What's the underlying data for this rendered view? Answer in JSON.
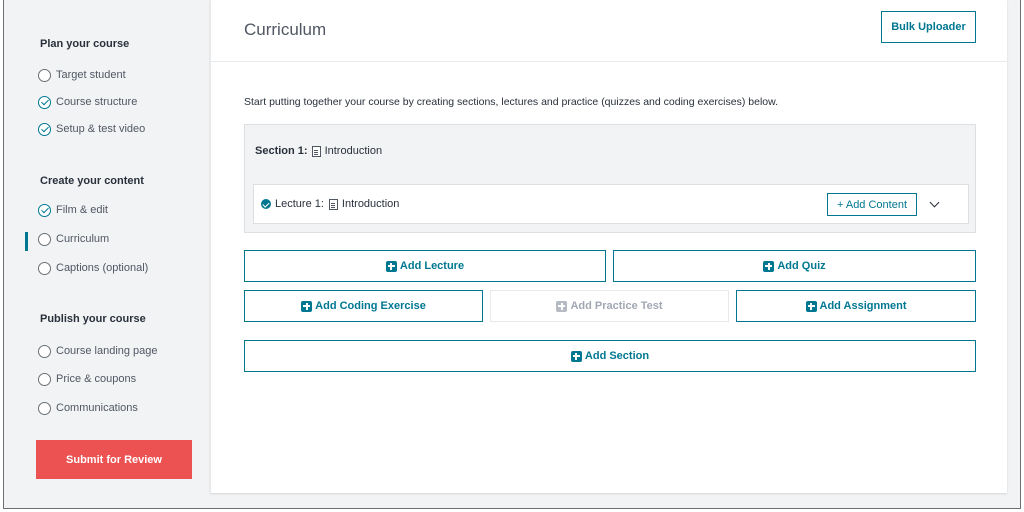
{
  "sidebar": {
    "groups": [
      {
        "title": "Plan your course",
        "items": [
          {
            "label": "Target student",
            "done": false
          },
          {
            "label": "Course structure",
            "done": true
          },
          {
            "label": "Setup & test video",
            "done": true
          }
        ]
      },
      {
        "title": "Create your content",
        "items": [
          {
            "label": "Film & edit",
            "done": true
          },
          {
            "label": "Curriculum",
            "done": false,
            "active": true
          },
          {
            "label": "Captions (optional)",
            "done": false
          }
        ]
      },
      {
        "title": "Publish your course",
        "items": [
          {
            "label": "Course landing page",
            "done": false
          },
          {
            "label": "Price & coupons",
            "done": false
          },
          {
            "label": "Communications",
            "done": false
          }
        ]
      }
    ],
    "submit_label": "Submit for Review"
  },
  "header": {
    "title": "Curriculum",
    "bulk_uploader_label": "Bulk Uploader"
  },
  "main": {
    "intro": "Start putting together your course by creating sections, lectures and practice (quizzes and coding exercises) below.",
    "section": {
      "number_label": "Section 1:",
      "title": "Introduction",
      "lecture": {
        "number_label": "Lecture 1:",
        "title": "Introduction",
        "add_content_label": "+ Add Content"
      }
    },
    "actions": {
      "add_lecture": "Add Lecture",
      "add_quiz": "Add Quiz",
      "add_coding_exercise": "Add Coding Exercise",
      "add_practice_test": "Add Practice Test",
      "add_assignment": "Add Assignment",
      "add_section": "Add Section"
    }
  },
  "colors": {
    "accent": "#007791",
    "submit": "#ec5252",
    "sidebar_bg": "#f2f3f5"
  }
}
